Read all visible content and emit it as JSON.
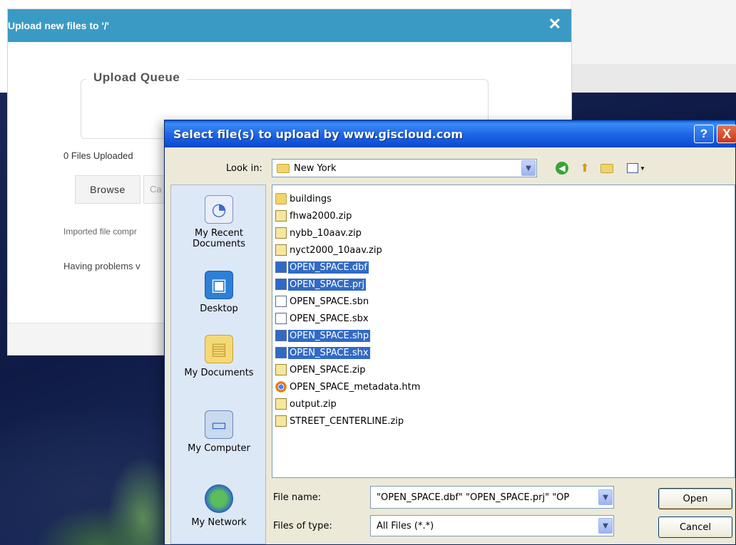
{
  "web_dialog": {
    "title": "Upload new files to '/'",
    "close_glyph": "✕",
    "queue_legend": "Upload Queue",
    "files_uploaded": "0 Files Uploaded",
    "browse_label": "Browse",
    "cancel_label": "Ca",
    "imported_text": "Imported file compr",
    "problems_text": "Having problems v"
  },
  "file_dialog": {
    "title": "Select file(s) to upload by www.giscloud.com",
    "help_glyph": "?",
    "close_glyph": "X",
    "look_in_label": "Look in:",
    "look_in_value": "New York",
    "places": [
      {
        "label": "My Recent Documents",
        "icon": "recent-documents-icon"
      },
      {
        "label": "Desktop",
        "icon": "desktop-icon"
      },
      {
        "label": "My Documents",
        "icon": "my-documents-icon"
      },
      {
        "label": "My Computer",
        "icon": "my-computer-icon"
      },
      {
        "label": "My Network",
        "icon": "network-icon"
      }
    ],
    "files": [
      {
        "name": "buildings",
        "type": "folder",
        "selected": false
      },
      {
        "name": "fhwa2000.zip",
        "type": "zip",
        "selected": false
      },
      {
        "name": "nybb_10aav.zip",
        "type": "zip",
        "selected": false
      },
      {
        "name": "nyct2000_10aav.zip",
        "type": "zip",
        "selected": false
      },
      {
        "name": "OPEN_SPACE.dbf",
        "type": "doc",
        "selected": true
      },
      {
        "name": "OPEN_SPACE.prj",
        "type": "doc",
        "selected": true
      },
      {
        "name": "OPEN_SPACE.sbn",
        "type": "doc",
        "selected": false
      },
      {
        "name": "OPEN_SPACE.sbx",
        "type": "doc",
        "selected": false
      },
      {
        "name": "OPEN_SPACE.shp",
        "type": "doc",
        "selected": true
      },
      {
        "name": "OPEN_SPACE.shx",
        "type": "doc",
        "selected": true
      },
      {
        "name": "OPEN_SPACE.zip",
        "type": "zip",
        "selected": false
      },
      {
        "name": "OPEN_SPACE_metadata.htm",
        "type": "chrome",
        "selected": false
      },
      {
        "name": "output.zip",
        "type": "zip",
        "selected": false
      },
      {
        "name": "STREET_CENTERLINE.zip",
        "type": "zip",
        "selected": false
      }
    ],
    "file_name_label": "File name:",
    "file_name_value": "\"OPEN_SPACE.dbf\" \"OPEN_SPACE.prj\" \"OP",
    "file_type_label": "Files of type:",
    "file_type_value": "All Files (*.*)",
    "open_label": "Open",
    "cancel_label": "Cancel"
  },
  "colors": {
    "web_titlebar": "#3b9ac4",
    "xp_titlebar": "#0a58dc",
    "selection": "#316ac5"
  }
}
